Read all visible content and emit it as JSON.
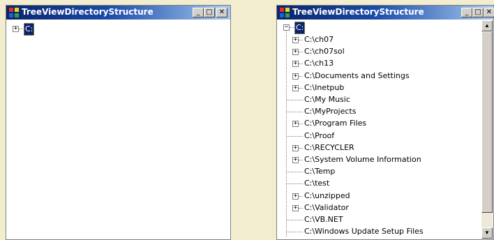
{
  "left_window": {
    "title": "TreeViewDirectoryStructure",
    "buttons": {
      "minimize": "_",
      "maximize": "□",
      "close": "✕"
    },
    "root": {
      "label": "C:",
      "expander": "+"
    }
  },
  "right_window": {
    "title": "TreeViewDirectoryStructure",
    "buttons": {
      "minimize": "_",
      "maximize": "□",
      "close": "✕"
    },
    "root": {
      "label": "C:",
      "expander": "−"
    },
    "items": [
      {
        "label": "C:\\ch07",
        "expander": "+"
      },
      {
        "label": "C:\\ch07sol",
        "expander": "+"
      },
      {
        "label": "C:\\ch13",
        "expander": "+"
      },
      {
        "label": "C:\\Documents and Settings",
        "expander": "+"
      },
      {
        "label": "C:\\Inetpub",
        "expander": "+"
      },
      {
        "label": "C:\\My Music",
        "expander": ""
      },
      {
        "label": "C:\\MyProjects",
        "expander": ""
      },
      {
        "label": "C:\\Program Files",
        "expander": "+"
      },
      {
        "label": "C:\\Proof",
        "expander": ""
      },
      {
        "label": "C:\\RECYCLER",
        "expander": "+"
      },
      {
        "label": "C:\\System Volume Information",
        "expander": "+"
      },
      {
        "label": "C:\\Temp",
        "expander": ""
      },
      {
        "label": "C:\\test",
        "expander": ""
      },
      {
        "label": "C:\\unzipped",
        "expander": "+"
      },
      {
        "label": "C:\\Validator",
        "expander": "+"
      },
      {
        "label": "C:\\VB.NET",
        "expander": ""
      },
      {
        "label": "C:\\Windows Update Setup Files",
        "expander": ""
      }
    ],
    "scrollbar": {
      "up_arrow": "▲",
      "down_arrow": "▼"
    }
  },
  "colors": {
    "titlebar_start": "#0a246a",
    "titlebar_end": "#a6caf0",
    "selection": "#0a246a",
    "background": "#f3edcf"
  }
}
